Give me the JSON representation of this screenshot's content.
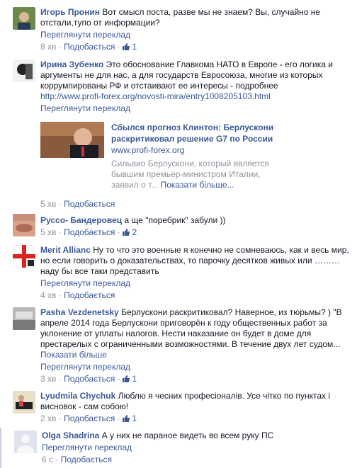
{
  "like_label": "Подобається",
  "translate_label": "Переглянути переклад",
  "comments": [
    {
      "author": "Игорь Пронин",
      "text": "Вот смысл поста, разве мы не знаем? Вы, случайно не отстали,тупо от информации?",
      "time": "8 хв",
      "likes": "1"
    },
    {
      "author": "Ирина Зубенко",
      "text": "Это обоснование Главкома НАТО в Европе - его логика и аргументы не для нас, а для государств Евросоюза, многие из которых коррумпированы РФ и отстаивают ее интересы - подробнее",
      "link": "http://www.profi-forex.org/novosti-mira/entry1008205103.html",
      "time": "5 хв",
      "preview": {
        "title": "Сбылся прогноз Клинтон: Берлускони раскритиковал решение G7 по России",
        "domain": "www.profi-forex.org",
        "desc": "Сильвио Берлускони, который является бывшим премьер-министром Италии, заявил о т...",
        "more": "Показати більше..."
      }
    },
    {
      "author": "Руссо- Бандеровец",
      "text": "а ще \"поребрик\" забули ))",
      "time": "5 хв",
      "likes": "2"
    },
    {
      "author": "Merit Allianc",
      "text": "Ну то что это военные я конечно не сомневаюсь, как и весь мир, но если говорить о доказательствах, то парочку десятков живых или ……… наду бы все таки предстaвить",
      "time": "4 хв"
    },
    {
      "author": "Pasha Vezdenetsky",
      "text": "Берлускони раскритиковал? Наверное, из тюрьмы? ) \"В апреле 2014 года Берлускони приговорён к году общественных работ за уклонение от уплаты налогов. Нести наказание он будет в доме для престарелых с ограниченными возможностями. В течение двух лет судом...",
      "more": "Показати більше",
      "time": "3 хв",
      "likes": "1"
    },
    {
      "author": "Lyudmila Chychuk",
      "text": "Люблю я чесних професіоналів. Усе чітко по пунктах і висновок - сам собою!",
      "time": "2 хв",
      "likes": "1"
    },
    {
      "author": "Olga Shadrina",
      "text": "А у них не параное видеть во всем руку ПС",
      "time": "6 с"
    }
  ]
}
